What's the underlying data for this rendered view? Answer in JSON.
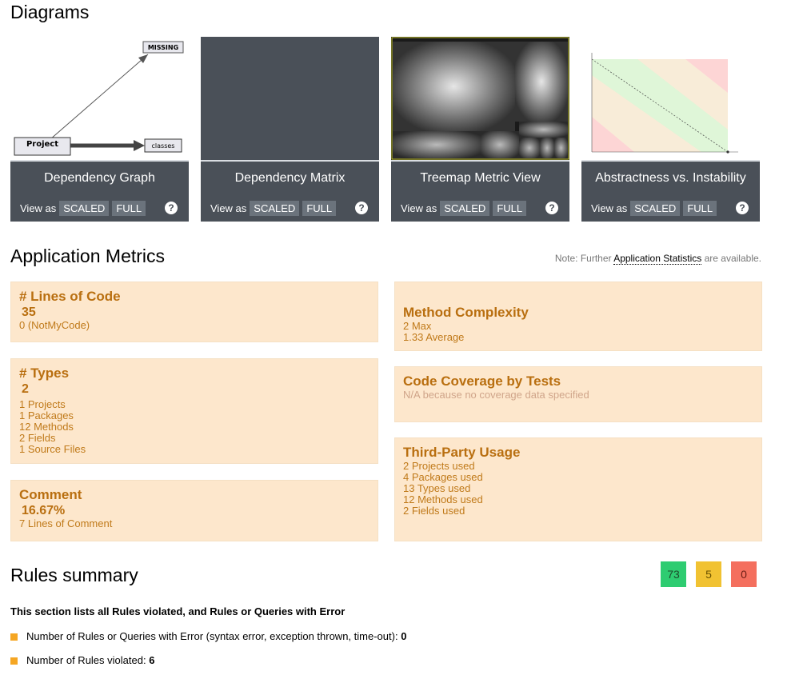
{
  "diagrams": {
    "heading": "Diagrams",
    "view_as": "View as",
    "scaled": "SCALED",
    "full": "FULL",
    "help": "?",
    "cards": [
      {
        "title": "Dependency Graph"
      },
      {
        "title": "Dependency Matrix"
      },
      {
        "title": "Treemap Metric View"
      },
      {
        "title": "Abstractness vs. Instability"
      }
    ],
    "graph_nodes": {
      "missing": "MISSING",
      "project": "Project",
      "classes": "classes"
    }
  },
  "metrics": {
    "heading": "Application Metrics",
    "note_prefix": "Note: Further",
    "note_link": "Application Statistics",
    "note_suffix": "are available.",
    "loc": {
      "title": "# Lines of Code",
      "value": "35",
      "notmycode": "0 (NotMyCode)"
    },
    "types": {
      "title": "# Types",
      "value": "2",
      "rows": [
        "1   Projects",
        "1   Packages",
        "12   Methods",
        "2   Fields",
        "1   Source Files"
      ]
    },
    "comment": {
      "title": "Comment",
      "value": "16.67%",
      "rows": [
        "7   Lines of Comment"
      ]
    },
    "complexity": {
      "title": "Method Complexity",
      "rows": [
        "2   Max",
        "1.33   Average"
      ]
    },
    "coverage": {
      "title": "Code Coverage by Tests",
      "note": "N/A because no coverage data specified"
    },
    "thirdparty": {
      "title": "Third-Party Usage",
      "rows": [
        "2   Projects used",
        "4   Packages used",
        "13   Types used",
        "12   Methods used",
        "2   Fields used"
      ]
    }
  },
  "rules": {
    "heading": "Rules summary",
    "badges": {
      "ok": "73",
      "warn": "5",
      "error": "0"
    },
    "colors": {
      "ok": "#2ecc71",
      "warn": "#f1c232",
      "error": "#f46f5e"
    },
    "intro": "This section lists all Rules violated, and Rules or Queries with Error",
    "item1_label": "Number of Rules or Queries with Error (syntax error, exception thrown, time-out):",
    "item1_value": "0",
    "item2_label": "Number of Rules violated:",
    "item2_value": "6"
  }
}
